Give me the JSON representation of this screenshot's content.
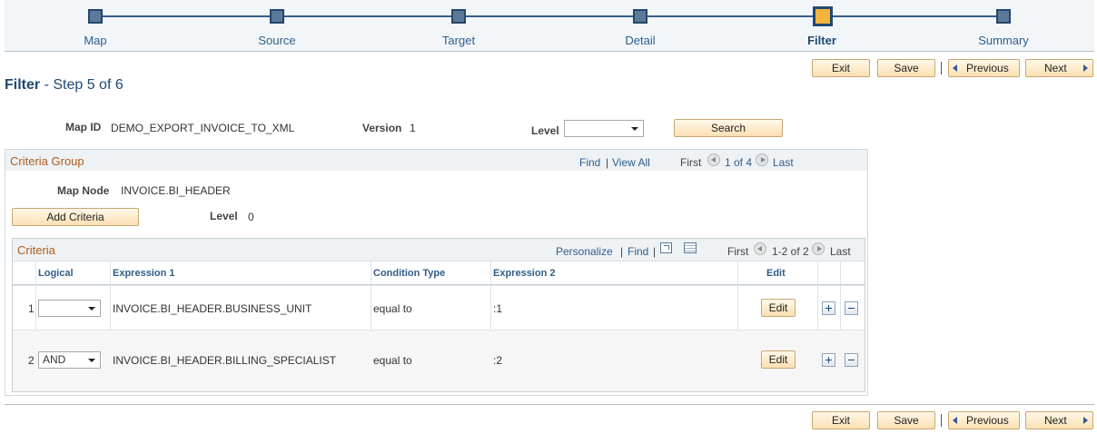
{
  "train": {
    "steps": [
      {
        "label": "Map",
        "active": false
      },
      {
        "label": "Source",
        "active": false
      },
      {
        "label": "Target",
        "active": false
      },
      {
        "label": "Detail",
        "active": false
      },
      {
        "label": "Filter",
        "active": true
      },
      {
        "label": "Summary",
        "active": false
      }
    ]
  },
  "toolbar": {
    "exit": "Exit",
    "save": "Save",
    "previous": "Previous",
    "next": "Next"
  },
  "page": {
    "title_bold": "Filter",
    "title_rest": " - Step 5 of 6"
  },
  "form": {
    "map_id_label": "Map ID",
    "map_id_value": "DEMO_EXPORT_INVOICE_TO_XML",
    "version_label": "Version",
    "version_value": "1",
    "level_label": "Level",
    "level_value": "",
    "search_button": "Search"
  },
  "criteria_group": {
    "title": "Criteria Group",
    "find": "Find",
    "view_all": "View All",
    "first": "First",
    "range": "1 of 4",
    "last": "Last",
    "map_node_label": "Map Node",
    "map_node_value": "INVOICE.BI_HEADER",
    "add_criteria": "Add Criteria",
    "level_label": "Level",
    "level_value": "0"
  },
  "criteria": {
    "title": "Criteria",
    "personalize": "Personalize",
    "find": "Find",
    "first": "First",
    "range": "1-2 of 2",
    "last": "Last",
    "columns": [
      "Logical",
      "Expression 1",
      "Condition Type",
      "Expression 2",
      "Edit"
    ],
    "rows": [
      {
        "num": "1",
        "logical": "",
        "expression1": "INVOICE.BI_HEADER.BUSINESS_UNIT",
        "condition": "equal to",
        "expression2": ":1",
        "edit": "Edit"
      },
      {
        "num": "2",
        "logical": "AND",
        "expression1": "INVOICE.BI_HEADER.BILLING_SPECIALIST",
        "condition": "equal to",
        "expression2": ":2",
        "edit": "Edit"
      }
    ]
  },
  "colors": {
    "accent": "#1f4973",
    "link": "#2f5d8a",
    "active_step": "#f7b43d",
    "group_title": "#b05b1b"
  }
}
